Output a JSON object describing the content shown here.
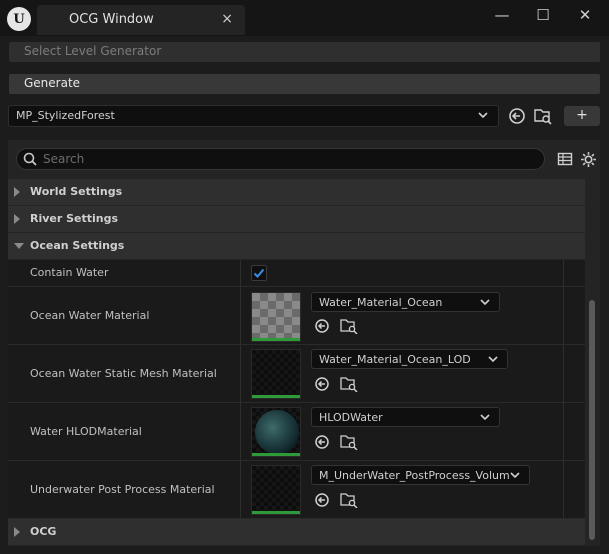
{
  "window": {
    "tab_title": "OCG Window",
    "tab_close": "×",
    "controls": {
      "minimize": "—",
      "maximize": "☐",
      "close": "✕"
    }
  },
  "logo": {
    "glyph": "U"
  },
  "toolbar": {
    "level_generator_placeholder": "Select Level Generator",
    "generate_label": "Generate",
    "selected_asset": "MP_StylizedForest",
    "add_label": "+"
  },
  "search": {
    "placeholder": "Search"
  },
  "categories": {
    "world": "World Settings",
    "river": "River Settings",
    "ocean": "Ocean Settings",
    "ocg": "OCG"
  },
  "ocean": {
    "contain_water": {
      "label": "Contain Water",
      "checked": true
    },
    "properties": [
      {
        "label": "Ocean Water Material",
        "value": "Water_Material_Ocean",
        "thumbnail": "checker"
      },
      {
        "label": "Ocean Water Static Mesh Material",
        "value": "Water_Material_Ocean_LOD",
        "thumbnail": "dark"
      },
      {
        "label": "Water HLODMaterial",
        "value": "HLODWater",
        "thumbnail": "sphere"
      },
      {
        "label": "Underwater Post Process Material",
        "value": "M_UnderWater_PostProcess_Volume",
        "thumbnail": "dark"
      }
    ]
  },
  "colors": {
    "accent_green": "#2f9a3a",
    "checkbox_blue": "#3a8fe8",
    "panel": "#242424",
    "category": "#2f2f2f"
  },
  "icons": [
    "app-logo-icon",
    "close-icon",
    "minimize-icon",
    "maximize-icon",
    "chevron-down-icon",
    "use-selected-icon",
    "browse-folder-icon",
    "search-icon",
    "table-icon",
    "gear-icon",
    "checkmark-icon"
  ]
}
